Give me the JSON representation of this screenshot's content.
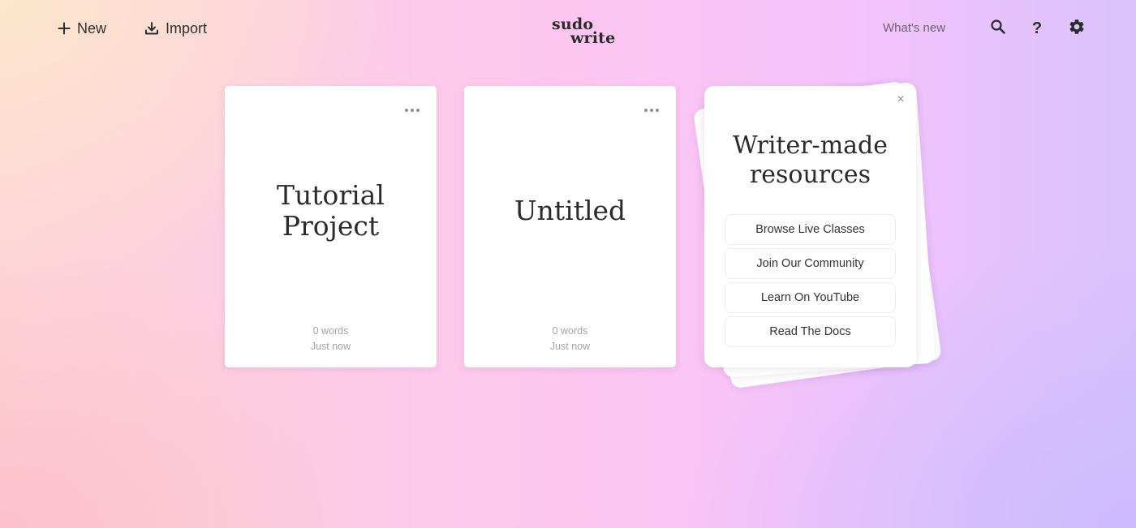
{
  "header": {
    "new_label": "New",
    "import_label": "Import",
    "logo_line1": "sudo",
    "logo_line2": "write",
    "whats_new_label": "What's new",
    "help_label": "?"
  },
  "projects": [
    {
      "title": "Tutorial Project",
      "words": "0 words",
      "updated": "Just now"
    },
    {
      "title": "Untitled",
      "words": "0 words",
      "updated": "Just now"
    }
  ],
  "resources": {
    "title": "Writer-made resources",
    "close_label": "×",
    "buttons": [
      "Browse Live Classes",
      "Join Our Community",
      "Learn On YouTube",
      "Read The Docs"
    ]
  },
  "icons": {
    "new": "plus-icon",
    "import": "download-icon",
    "search": "search-icon",
    "help": "question-mark-icon",
    "settings": "gear-icon",
    "card_menu": "more-horizontal-icon",
    "close": "close-icon"
  },
  "colors": {
    "text": "#2b2b2b",
    "muted": "#a3a3a3",
    "card": "#ffffff"
  }
}
